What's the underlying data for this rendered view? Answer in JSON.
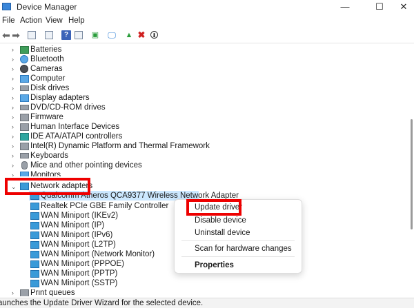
{
  "window": {
    "title": "Device Manager",
    "controls": {
      "minimize": "—",
      "maximize": "☐",
      "close": "✕"
    }
  },
  "menubar": {
    "items": [
      "File",
      "Action",
      "View",
      "Help"
    ]
  },
  "tree": {
    "categories": [
      "Batteries",
      "Bluetooth",
      "Cameras",
      "Computer",
      "Disk drives",
      "Display adapters",
      "DVD/CD-ROM drives",
      "Firmware",
      "Human Interface Devices",
      "IDE ATA/ATAPI controllers",
      "Intel(R) Dynamic Platform and Thermal Framework",
      "Keyboards",
      "Mice and other pointing devices",
      "Monitors"
    ],
    "expanded": {
      "label": "Network adapters",
      "children": [
        "Qualcomm Atheros QCA9377 Wireless Network Adapter",
        "Realtek PCIe GBE Family Controller",
        "WAN Miniport (IKEv2)",
        "WAN Miniport (IP)",
        "WAN Miniport (IPv6)",
        "WAN Miniport (L2TP)",
        "WAN Miniport (Network Monitor)",
        "WAN Miniport (PPPOE)",
        "WAN Miniport (PPTP)",
        "WAN Miniport (SSTP)"
      ]
    },
    "after": [
      "Print queues"
    ]
  },
  "context_menu": {
    "items": [
      "Update driver",
      "Disable device",
      "Uninstall device",
      "Scan for hardware changes",
      "Properties"
    ]
  },
  "status": {
    "text": "aunches the Update Driver Wizard for the selected device."
  },
  "colors": {
    "highlight_box": "#ee0000",
    "selection": "#cce8ff"
  }
}
